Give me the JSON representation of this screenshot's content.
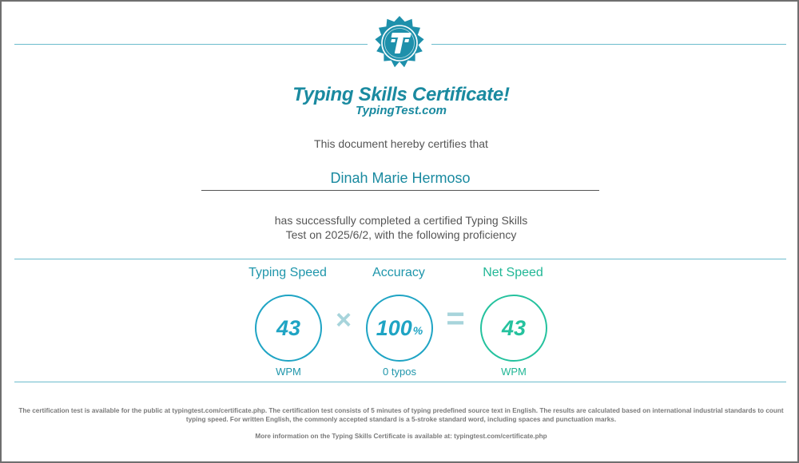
{
  "certificate": {
    "title": "Typing Skills Certificate!",
    "subtitle": "TypingTest.com",
    "certifies_text": "This document hereby certifies that",
    "name": "Dinah Marie Hermoso",
    "completed_line1": "has successfully completed a certified Typing Skills",
    "completed_line2": "Test on 2025/6/2, with the following proficiency"
  },
  "metrics": {
    "speed": {
      "label": "Typing Speed",
      "value": "43",
      "unit": "WPM"
    },
    "accuracy": {
      "label": "Accuracy",
      "value": "100",
      "suffix": "%",
      "unit": "0 typos"
    },
    "net": {
      "label": "Net Speed",
      "value": "43",
      "unit": "WPM"
    },
    "times_symbol": "×",
    "equals_symbol": "="
  },
  "footer": {
    "paragraph": "The certification test is available for the public at typingtest.com/certificate.php. The certification test consists of 5 minutes of typing predefined source text in English. The results are calculated based on international industrial standards to count typing speed. For written English, the commonly accepted standard is a 5-stroke standard word, including spaces and punctuation marks.",
    "more_info": "More information on the Typing Skills Certificate is available at: typingtest.com/certificate.php"
  },
  "colors": {
    "accent_blue": "#1a8aa0",
    "circle_blue": "#1fa4c4",
    "net_green": "#25c29e",
    "operator": "#a7d4db",
    "rule_line": "#6cbccd"
  },
  "icons": {
    "seal": "typingtest-seal-logo-icon"
  }
}
